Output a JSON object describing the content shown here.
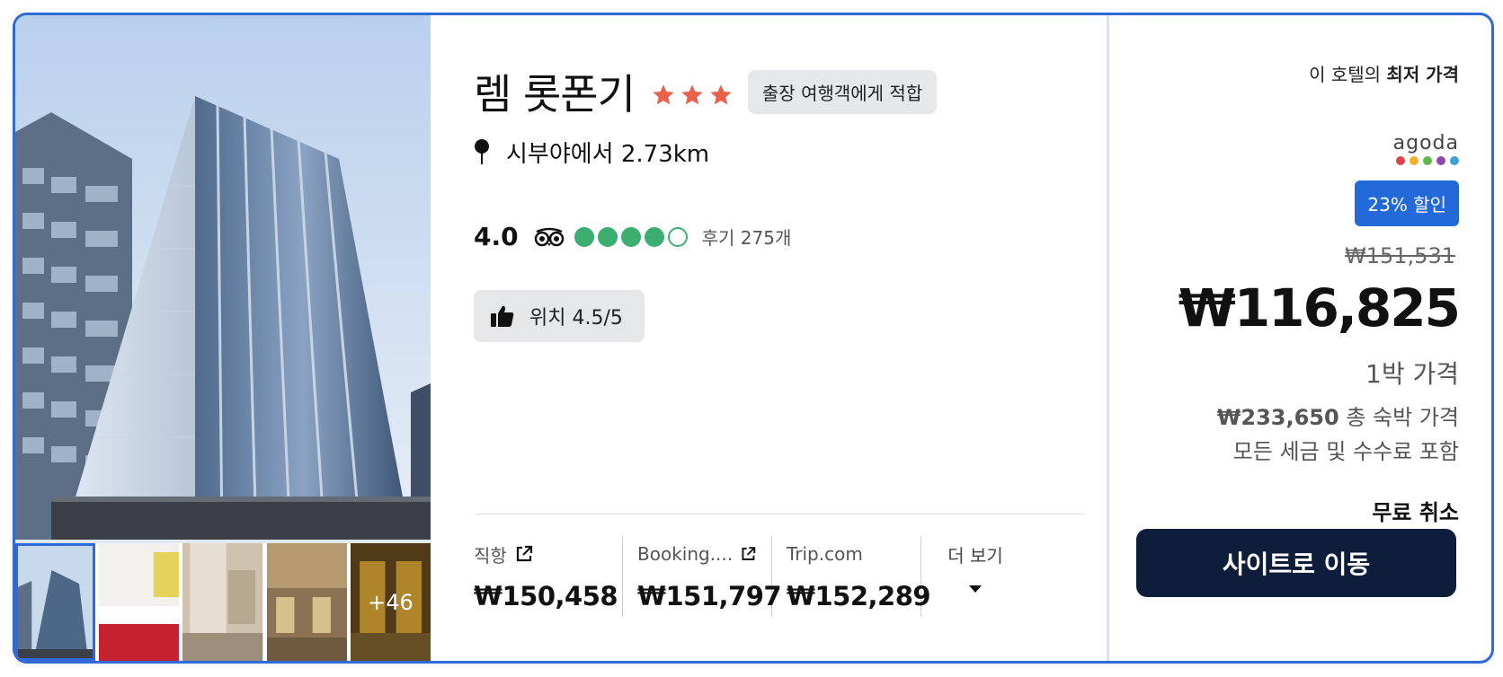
{
  "hotel": {
    "name": "렘 롯폰기",
    "star_count": 3,
    "star_color": "#e8614a",
    "badge": "출장 여행객에게 적합",
    "distance": "시부야에서 2.73km",
    "rating": "4.0",
    "rating_bubbles": 4,
    "rating_bubbles_total": 5,
    "bubble_color": "#3cae70",
    "review_count": "후기 275개",
    "location_score": "위치 4.5/5"
  },
  "photos": {
    "more_count": "+46"
  },
  "offers": [
    {
      "name": "직항",
      "price": "₩150,458"
    },
    {
      "name": "Booking....",
      "price": "₩151,797"
    },
    {
      "name": "Trip.com",
      "price": "₩152,289"
    }
  ],
  "more_label": "더 보기",
  "price_panel": {
    "best_prefix": "이 호텔의 ",
    "best_bold": "최저 가격",
    "provider": "agoda",
    "provider_dot_colors": [
      "#e2424b",
      "#f4b02a",
      "#5cb947",
      "#8f4bab",
      "#3a9ee0"
    ],
    "discount": "23% 할인",
    "original_price": "₩151,531",
    "price": "₩116,825",
    "per_night": "1박 가격",
    "total_price": "₩233,650",
    "total_label": " 총 숙박 가격",
    "tax_note": "모든 세금 및 수수료 포함",
    "free_cancel": "무료 취소",
    "cta": "사이트로 이동"
  },
  "colors": {
    "card_border": "#2f6ad9",
    "cta_bg": "#0e1e3a",
    "discount_bg": "#2469d9"
  }
}
